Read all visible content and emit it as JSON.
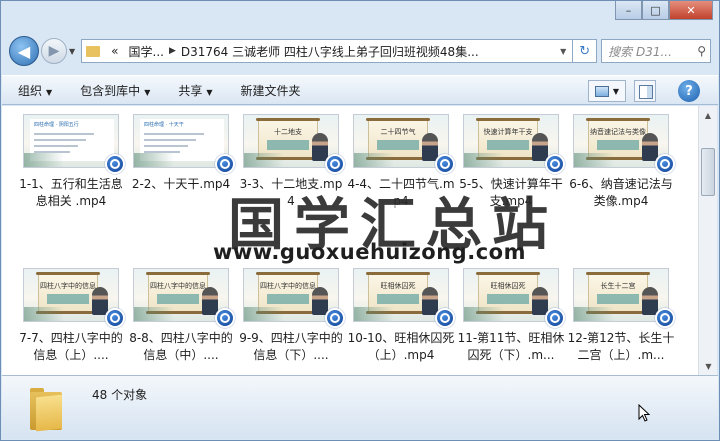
{
  "window": {
    "controls": {
      "minimize": "–",
      "maximize": "□",
      "close": "✕"
    }
  },
  "navigation": {
    "back_icon": "arrow-left-icon",
    "forward_icon": "arrow-right-icon",
    "breadcrumb_prefix": "«",
    "breadcrumbs": [
      "国学...",
      "D31764 三诚老师 四柱八字线上弟子回归班视频48集..."
    ],
    "search_placeholder": "搜索 D31..."
  },
  "toolbar": {
    "organize": "组织",
    "include_in_library": "包含到库中",
    "share": "共享",
    "new_folder": "新建文件夹"
  },
  "files": [
    {
      "name": "1-1、五行和生活息息相关 .mp4",
      "thumb_title": "",
      "style": "paper",
      "head": "四柱命理 · 阴阳五行"
    },
    {
      "name": "2-2、十天干.mp4",
      "thumb_title": "",
      "style": "paper",
      "head": "四柱命理 · 十天干"
    },
    {
      "name": "3-3、十二地支.mp4",
      "thumb_title": "十二地支",
      "style": "scroll"
    },
    {
      "name": "4-4、二十四节气.mp4",
      "thumb_title": "二十四节气",
      "style": "scroll"
    },
    {
      "name": "5-5、快速计算年干支.mp4",
      "thumb_title": "快速计算年干支",
      "style": "scroll"
    },
    {
      "name": "6-6、纳音速记法与类像.mp4",
      "thumb_title": "纳音速记法与类像",
      "style": "scroll"
    },
    {
      "name": "7-7、四柱八字中的信息（上）....",
      "thumb_title": "四柱八字中的信息",
      "style": "scroll"
    },
    {
      "name": "8-8、四柱八字中的信息（中）....",
      "thumb_title": "四柱八字中的信息",
      "style": "scroll"
    },
    {
      "name": "9-9、四柱八字中的信息（下）....",
      "thumb_title": "四柱八字中的信息",
      "style": "scroll"
    },
    {
      "name": "10-10、旺相休囚死（上）.mp4",
      "thumb_title": "旺相休囚死",
      "style": "scroll"
    },
    {
      "name": "11-第11节、旺相休囚死（下）.m...",
      "thumb_title": "旺相休囚死",
      "style": "scroll"
    },
    {
      "name": "12-第12节、长生十二宫（上）.m...",
      "thumb_title": "长生十二宫",
      "style": "scroll"
    }
  ],
  "watermark": {
    "title": "国学汇总站",
    "url": "www.guoxuehuizong.com"
  },
  "details": {
    "count_text": "48 个对象"
  }
}
